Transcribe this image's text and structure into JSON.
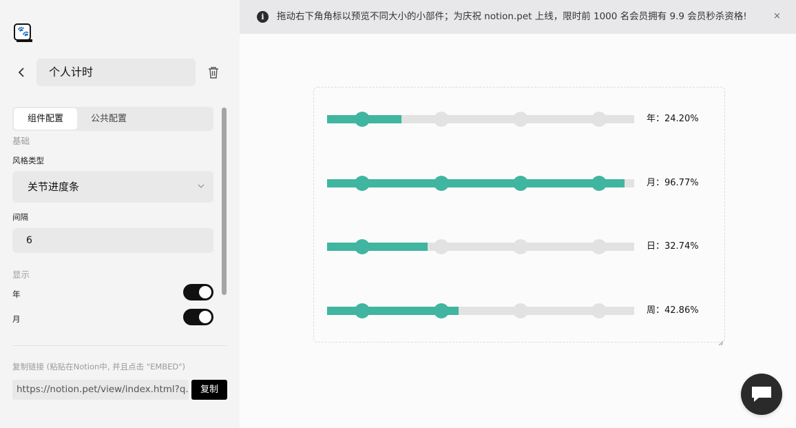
{
  "sidebar": {
    "title": "个人计时",
    "tabs": [
      "组件配置",
      "公共配置"
    ],
    "basic_section": "基础",
    "style_label": "风格类型",
    "style_value": "关节进度条",
    "interval_label": "间隔",
    "interval_value": "6",
    "display_section": "显示",
    "toggles": [
      {
        "label": "年",
        "on": true
      },
      {
        "label": "月",
        "on": true
      }
    ],
    "copy_hint": "复制链接 (粘贴在Notion中, 并且点击 \"EMBED\")",
    "link_value": "https://notion.pet/view/index.html?q...",
    "copy_button": "复制"
  },
  "notice": {
    "text": "拖动右下角角标以预览不同大小的小部件；为庆祝 notion.pet 上线，限时前 1000 名会员拥有 9.9 会员秒杀资格!",
    "close": "×"
  },
  "widget": {
    "accent_color": "#40b59f",
    "track_color": "#e2e2e2",
    "joints": [
      0.115,
      0.373,
      0.63,
      0.886
    ],
    "rows": [
      {
        "label": "年：24.20%",
        "fraction": 0.242
      },
      {
        "label": "月：96.77%",
        "fraction": 0.9677
      },
      {
        "label": "日：32.74%",
        "fraction": 0.3274
      },
      {
        "label": "周：42.86%",
        "fraction": 0.4286
      }
    ]
  },
  "icons": {
    "logo": "paw-logo-icon",
    "back": "chevron-left-icon",
    "trash": "trash-icon",
    "select": "chevron-down-icon",
    "info": "info-icon",
    "chat": "chat-icon"
  }
}
